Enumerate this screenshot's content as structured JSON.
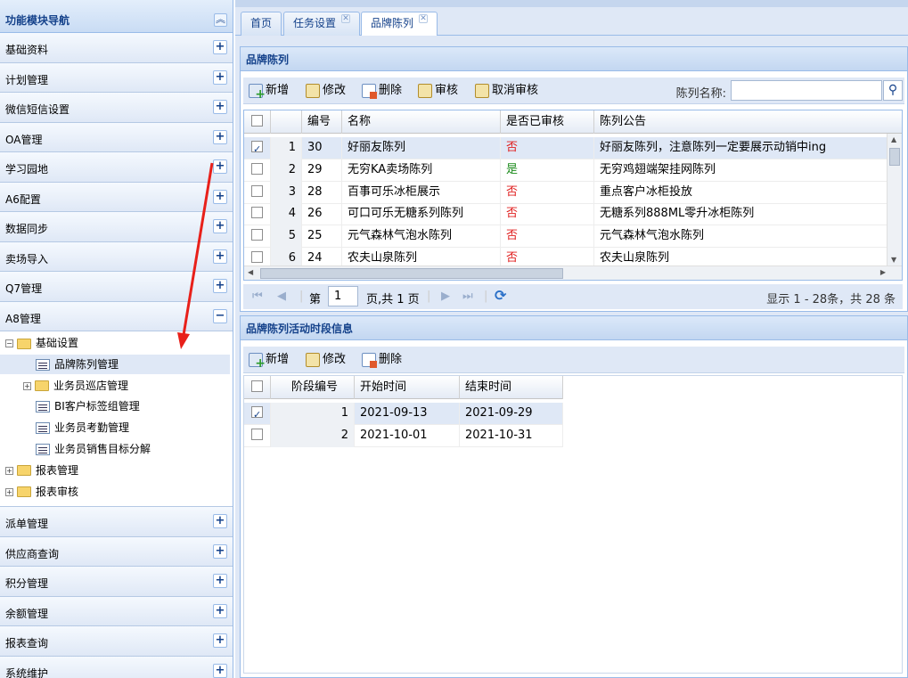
{
  "sidebar": {
    "title": "功能模块导航",
    "collapse_icon": "double-chevron-up-icon",
    "sections_top": [
      {
        "label": "基础资料",
        "toggle": "+"
      },
      {
        "label": "计划管理",
        "toggle": "+"
      },
      {
        "label": "微信短信设置",
        "toggle": "+"
      },
      {
        "label": "OA管理",
        "toggle": "+"
      },
      {
        "label": "学习园地",
        "toggle": "+"
      },
      {
        "label": "A6配置",
        "toggle": "+"
      },
      {
        "label": "数据同步",
        "toggle": "+"
      },
      {
        "label": "卖场导入",
        "toggle": "+"
      },
      {
        "label": "Q7管理",
        "toggle": "+"
      },
      {
        "label": "A8管理",
        "toggle": "−"
      }
    ],
    "tree": [
      {
        "label": "基础设置",
        "expander": "−",
        "type": "folder"
      },
      {
        "label": "品牌陈列管理",
        "type": "leaf",
        "selected": true
      },
      {
        "label": "业务员巡店管理",
        "expander": "+",
        "type": "folder"
      },
      {
        "label": "BI客户标签组管理",
        "type": "leaf"
      },
      {
        "label": "业务员考勤管理",
        "type": "leaf"
      },
      {
        "label": "业务员销售目标分解",
        "type": "leaf"
      },
      {
        "label": "报表管理",
        "expander": "+",
        "type": "folder"
      },
      {
        "label": "报表审核",
        "expander": "+",
        "type": "folder"
      }
    ],
    "sections_bottom": [
      {
        "label": "派单管理",
        "toggle": "+"
      },
      {
        "label": "供应商查询",
        "toggle": "+"
      },
      {
        "label": "积分管理",
        "toggle": "+"
      },
      {
        "label": "余额管理",
        "toggle": "+"
      },
      {
        "label": "报表查询",
        "toggle": "+"
      },
      {
        "label": "系统维护",
        "toggle": "+"
      }
    ]
  },
  "tabs": [
    {
      "label": "首页",
      "closable": false
    },
    {
      "label": "任务设置",
      "closable": true
    },
    {
      "label": "品牌陈列",
      "closable": true,
      "active": true
    }
  ],
  "panel1": {
    "title": "品牌陈列",
    "toolbar": {
      "add": "新增",
      "edit": "修改",
      "delete": "删除",
      "audit": "审核",
      "unaudit": "取消审核"
    },
    "search": {
      "label": "陈列名称:",
      "value": "",
      "icon": "search-icon"
    },
    "columns": [
      "编号",
      "名称",
      "是否已审核",
      "陈列公告"
    ],
    "rows": [
      {
        "n": "1",
        "id": "30",
        "name": "好丽友陈列",
        "audited": "否",
        "notice": "好丽友陈列，注意陈列一定要展示动销中ing",
        "checked": true
      },
      {
        "n": "2",
        "id": "29",
        "name": "无穷KA卖场陈列",
        "audited": "是",
        "notice": "无穷鸡翅端架挂网陈列",
        "checked": false
      },
      {
        "n": "3",
        "id": "28",
        "name": "百事可乐冰柜展示",
        "audited": "否",
        "notice": "重点客户冰柜投放",
        "checked": false
      },
      {
        "n": "4",
        "id": "26",
        "name": "可口可乐无糖系列陈列",
        "audited": "否",
        "notice": "无糖系列888ML零升冰柜陈列",
        "checked": false
      },
      {
        "n": "5",
        "id": "25",
        "name": "元气森林气泡水陈列",
        "audited": "否",
        "notice": "元气森林气泡水陈列",
        "checked": false
      },
      {
        "n": "6",
        "id": "24",
        "name": "农夫山泉陈列",
        "audited": "否",
        "notice": "农夫山泉陈列",
        "checked": false
      }
    ],
    "pager": {
      "page_prefix": "第",
      "page": "1",
      "page_suffix": "页,共 1 页",
      "summary": "显示 1 - 28条，共 28 条"
    }
  },
  "panel2": {
    "title": "品牌陈列活动时段信息",
    "toolbar": {
      "add": "新增",
      "edit": "修改",
      "delete": "删除"
    },
    "columns": [
      "阶段编号",
      "开始时间",
      "结束时间"
    ],
    "rows": [
      {
        "n": "1",
        "start": "2021-09-13",
        "end": "2021-09-29",
        "checked": true
      },
      {
        "n": "2",
        "start": "2021-10-01",
        "end": "2021-10-31",
        "checked": false
      }
    ]
  },
  "colors": {
    "header_blue": "#15428b",
    "border": "#99bbe8",
    "no_red": "#e02020",
    "yes_green": "#1a8a1a",
    "arrow": "#e8201a"
  }
}
